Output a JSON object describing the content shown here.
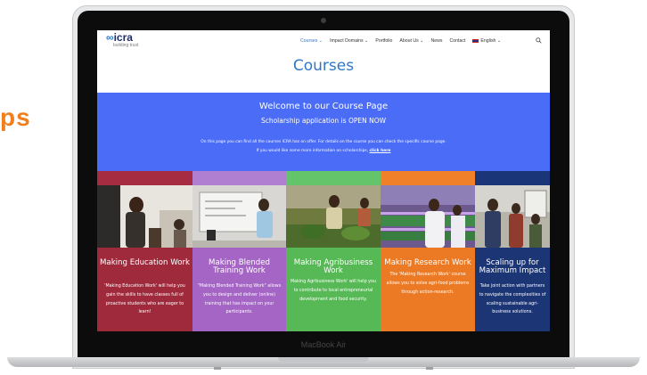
{
  "background_text": "ps",
  "device_label": "MacBook Air",
  "site": {
    "logo_text": "icra",
    "logo_tagline": "building trust",
    "nav": [
      {
        "label": "Courses ⌄",
        "active": true
      },
      {
        "label": "Impact Domains ⌄",
        "active": false
      },
      {
        "label": "Portfolio",
        "active": false
      },
      {
        "label": "About Us ⌄",
        "active": false
      },
      {
        "label": "News",
        "active": false
      },
      {
        "label": "Contact",
        "active": false
      },
      {
        "label": "English ⌄",
        "active": false
      }
    ],
    "search_icon": "magnifier"
  },
  "page_title": "Courses",
  "hero": {
    "title": "Welcome to our Course Page",
    "subtitle": "Scholarship application is OPEN NOW",
    "line1": "On this page you can find all the courses ICRA has on offer.  For details on the course you can check the specific course page.",
    "line2": "If you would like some more information on  scholarships, ",
    "link": "click here",
    "color": "#4a6cf7"
  },
  "cards": [
    {
      "title": "Making Education Work",
      "desc": "'Making Education Work' will help you gain the skills to have classes full of proactive students who are eager to learn!",
      "color": "#9e2a3c",
      "stripe": "#a62d41"
    },
    {
      "title": "Making Blended Training Work",
      "desc": "\"Making Blended Training Work\" allows you to design and deliver (online) training that has impact on your participants.",
      "color": "#a465c5",
      "stripe": "#b07fd1"
    },
    {
      "title": "Making Agribusiness Work",
      "desc": "Making Agribusiness Work' will help you to contribute to local entrepreneurial development and food security.",
      "color": "#57b955",
      "stripe": "#63c46a"
    },
    {
      "title": "Making Research Work",
      "desc": "The 'Making Research Work' course allows you to solve agri-food problems through action-research.",
      "color": "#ec7a24",
      "stripe": "#f1802a"
    },
    {
      "title": "Scaling up for Maximum Impact",
      "desc": "Take joint action with partners to navigate the complexities of scaling sustainable agri-business solutions.",
      "color": "#1b3575",
      "stripe": "#1b3678"
    }
  ]
}
